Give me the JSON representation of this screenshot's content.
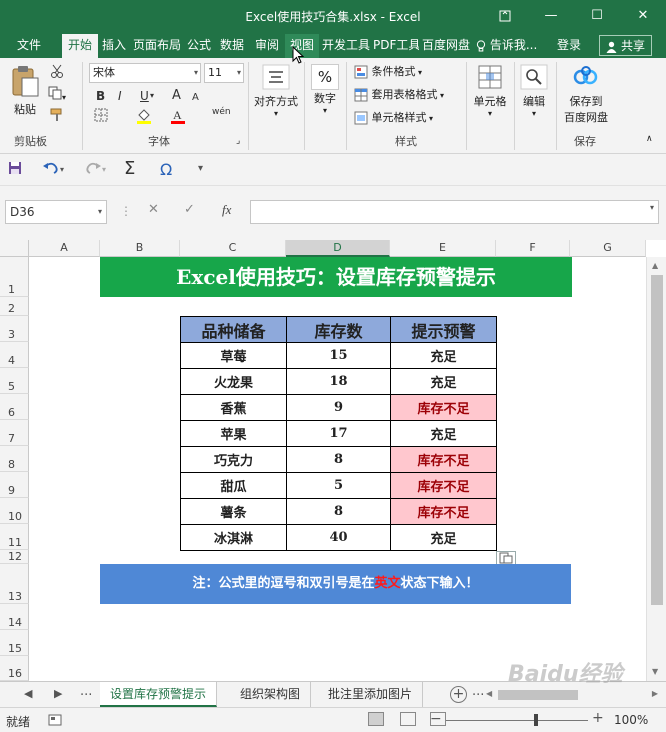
{
  "window": {
    "title": "Excel使用技巧合集.xlsx - Excel",
    "minimize": "—",
    "maximize": "☐",
    "close": "✕",
    "ribbon_display": "⬜"
  },
  "tabs": {
    "items": [
      {
        "label": "文件"
      },
      {
        "label": "开始"
      },
      {
        "label": "插入"
      },
      {
        "label": "页面布局"
      },
      {
        "label": "公式"
      },
      {
        "label": "数据"
      },
      {
        "label": "审阅"
      },
      {
        "label": "视图"
      },
      {
        "label": "开发工具"
      },
      {
        "label": "PDF工具"
      },
      {
        "label": "百度网盘"
      }
    ],
    "tell_me": "告诉我...",
    "login": "登录",
    "share": "共享"
  },
  "ribbon": {
    "clipboard": {
      "paste": "粘贴",
      "label": "剪贴板"
    },
    "font": {
      "name": "宋体",
      "size": "11",
      "bold": "B",
      "italic": "I",
      "underline": "U",
      "grow": "A",
      "shrink": "A",
      "wen": "wén",
      "label": "字体"
    },
    "alignment": {
      "label": "对齐方式"
    },
    "number": {
      "label": "数字",
      "symbol": "%"
    },
    "styles": {
      "conditional": "条件格式",
      "table": "套用表格格式",
      "cell": "单元格样式",
      "label": "样式"
    },
    "cells": {
      "label": "单元格"
    },
    "editing": {
      "label": "编辑"
    },
    "save": {
      "line1": "保存到",
      "line2": "百度网盘",
      "label": "保存"
    }
  },
  "formula_bar": {
    "name_box": "D36",
    "cancel": "✕",
    "enter": "✓",
    "fx": "fx",
    "formula": ""
  },
  "columns": [
    "A",
    "B",
    "C",
    "D",
    "E",
    "F",
    "G"
  ],
  "rows": [
    "1",
    "2",
    "3",
    "4",
    "5",
    "6",
    "7",
    "8",
    "9",
    "10",
    "11",
    "12",
    "13",
    "14",
    "15",
    "16"
  ],
  "sheet": {
    "banner": "Excel使用技巧：设置库存预警提示",
    "headers": [
      "品种储备",
      "库存数",
      "提示预警"
    ],
    "items": [
      {
        "name": "草莓",
        "qty": "15",
        "alert": "充足"
      },
      {
        "name": "火龙果",
        "qty": "18",
        "alert": "充足"
      },
      {
        "name": "香蕉",
        "qty": "9",
        "alert": "库存不足"
      },
      {
        "name": "苹果",
        "qty": "17",
        "alert": "充足"
      },
      {
        "name": "巧克力",
        "qty": "8",
        "alert": "库存不足"
      },
      {
        "name": "甜瓜",
        "qty": "5",
        "alert": "库存不足"
      },
      {
        "name": "薯条",
        "qty": "8",
        "alert": "库存不足"
      },
      {
        "name": "冰淇淋",
        "qty": "40",
        "alert": "充足"
      }
    ],
    "note_prefix": "注：公式里的逗号和双引号是在",
    "note_highlight": "英文",
    "note_suffix": "状态下输入！"
  },
  "sheet_tabs": {
    "tabs": [
      "设置库存预警提示",
      "组织架构图",
      "批注里添加图片"
    ],
    "more": "..."
  },
  "status": {
    "ready": "就绪",
    "zoom": "100%"
  },
  "watermark": "Baidu经验",
  "colors": {
    "excel_green": "#217346",
    "banner_green": "#17a64a",
    "header_blue": "#8ea9db",
    "note_blue": "#4f88d6",
    "warn_fill": "#ffc7ce",
    "warn_text": "#9c0006"
  }
}
